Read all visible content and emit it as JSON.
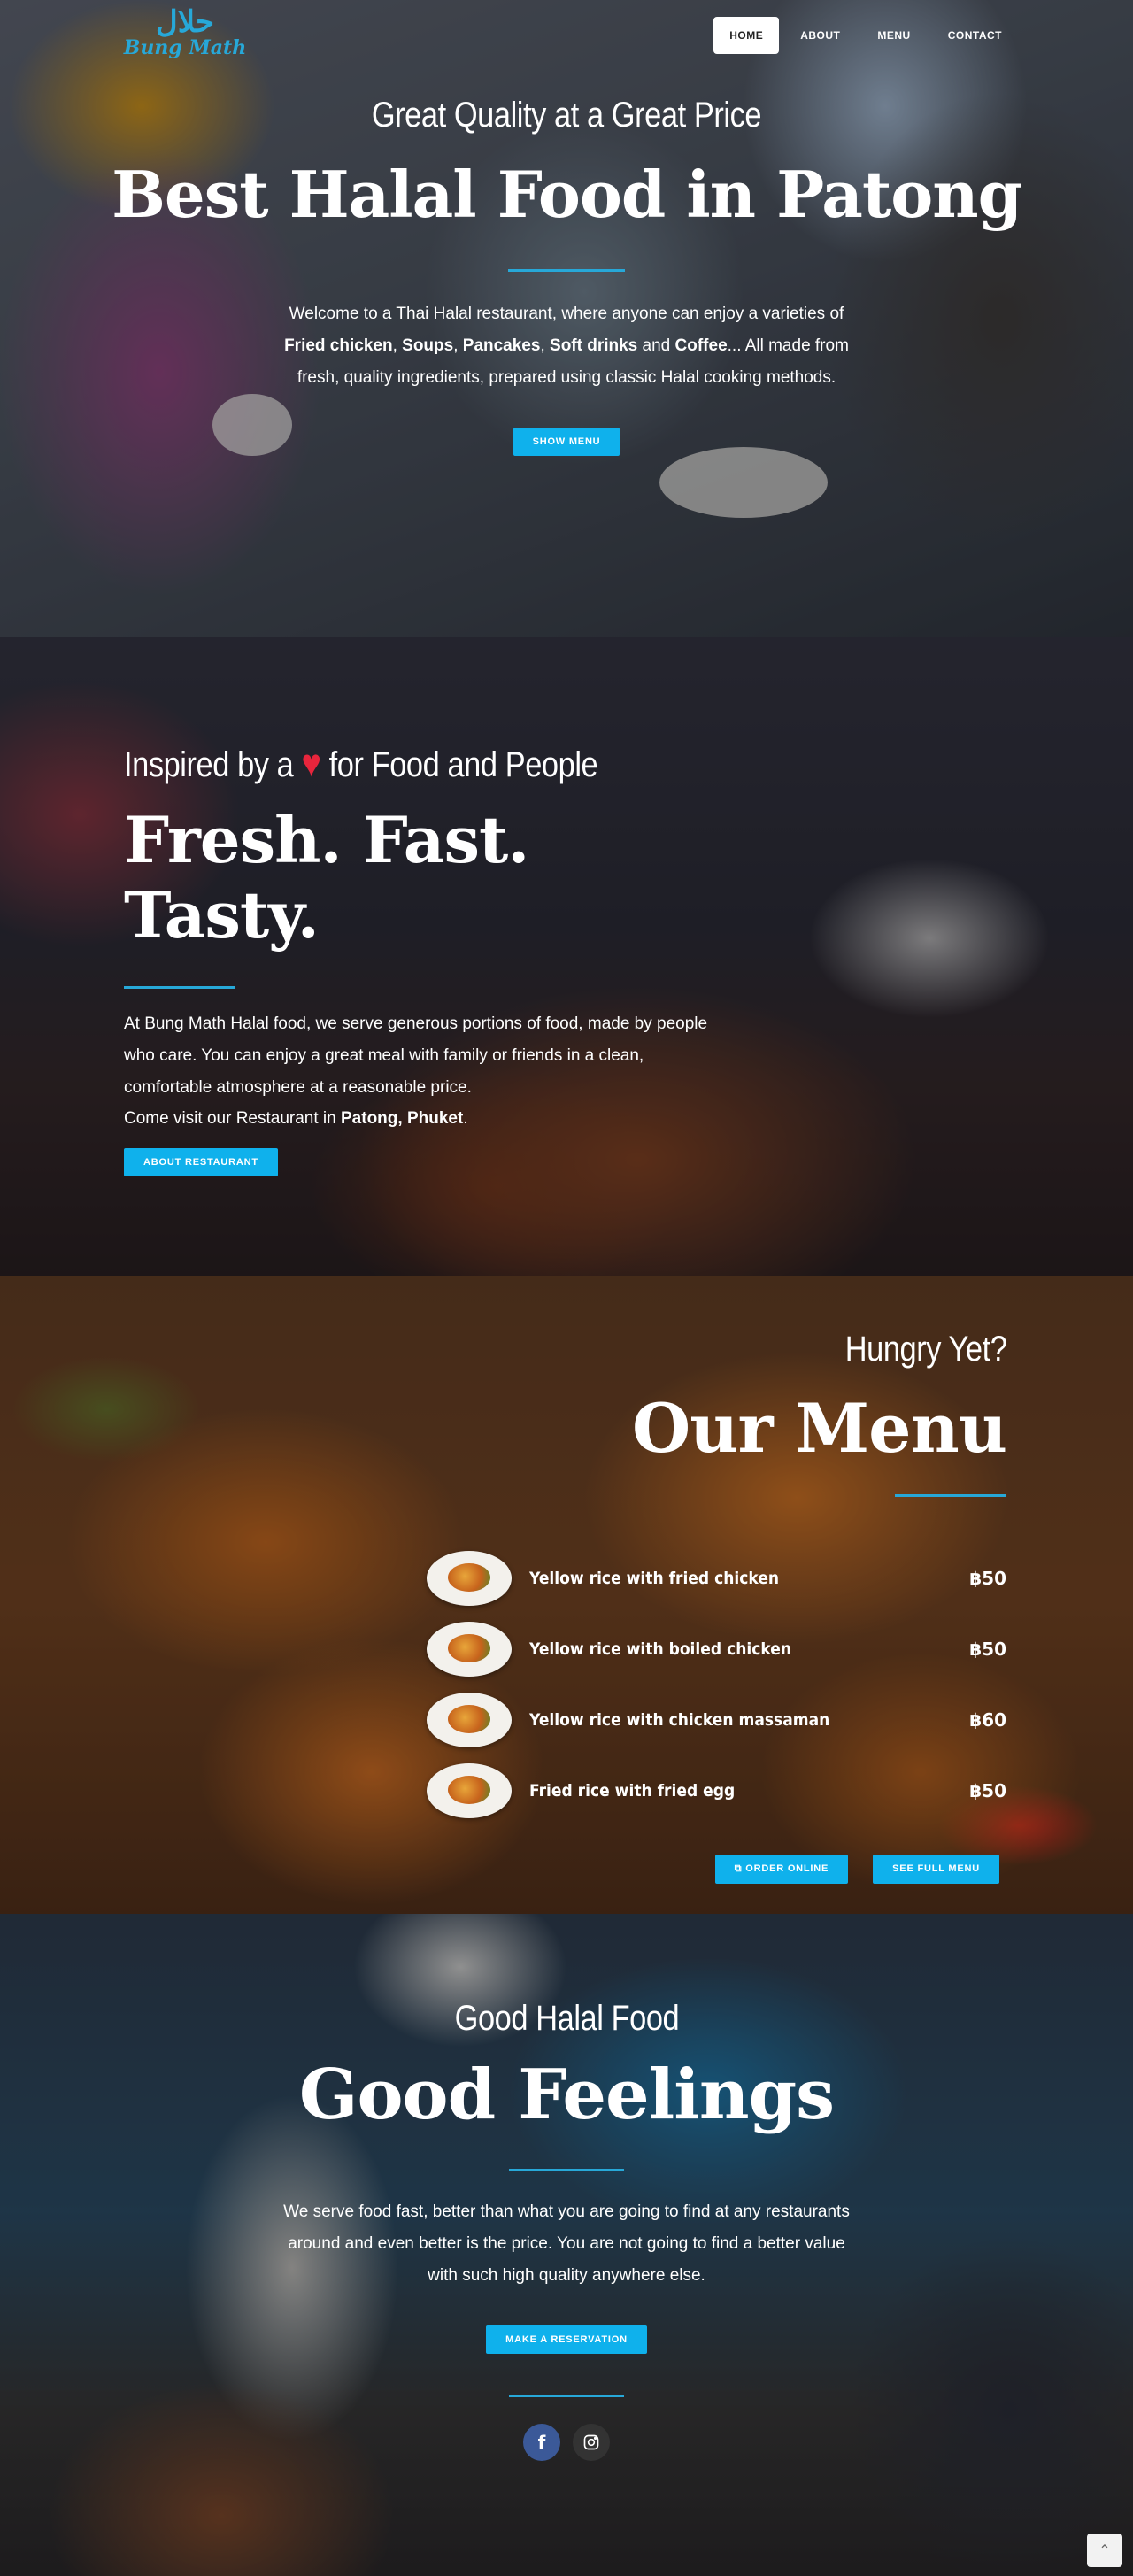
{
  "logo": {
    "arabic": "حلال",
    "name": "Bung Math"
  },
  "nav": {
    "items": [
      "HOME",
      "ABOUT",
      "MENU",
      "CONTACT"
    ]
  },
  "hero": {
    "subtitle": "Great Quality at a Great Price",
    "title": "Best Halal Food in Patong",
    "intro": "Welcome to a Thai Halal restaurant, where anyone can enjoy a varieties of ",
    "items": [
      "Fried chicken",
      "Soups",
      "Pancakes",
      "Soft drinks",
      "Coffee"
    ],
    "sep1": ", ",
    "sep2": ", ",
    "sep3": ", ",
    "and": " and ",
    "outro": "... All made from fresh, quality ingredients, prepared using classic Halal cooking methods.",
    "button": "SHOW MENU"
  },
  "about": {
    "subtitle_before": "Inspired by a ",
    "subtitle_after": " for Food and People",
    "title": "Fresh. Fast. Tasty.",
    "body": "At Bung Math Halal food, we serve generous portions of food, made by people who care. You can enjoy a great meal with family or friends in a clean, comfortable atmosphere at a reasonable price.",
    "visit_before": "Come visit our Restaurant in ",
    "visit_place": "Patong, Phuket",
    "visit_after": ".",
    "button": "ABOUT RESTAURANT"
  },
  "menu": {
    "subtitle": "Hungry Yet?",
    "title": "Our Menu",
    "items": [
      {
        "name": "Yellow rice with fried chicken",
        "price": "฿50"
      },
      {
        "name": "Yellow rice with boiled chicken",
        "price": "฿50"
      },
      {
        "name": "Yellow rice with chicken massaman",
        "price": "฿60"
      },
      {
        "name": "Fried rice with fried egg",
        "price": "฿50"
      }
    ],
    "order_button": "ORDER ONLINE",
    "full_menu_button": "SEE FULL MENU"
  },
  "feelings": {
    "subtitle": "Good Halal Food",
    "title": "Good Feelings",
    "body": "We serve food fast, better than what you are going to find at any restaurants around and even better is the price. You are not going to find a better value with such high quality anywhere else.",
    "button": "MAKE A RESERVATION",
    "social": {
      "facebook": "f"
    }
  },
  "colors": {
    "accent": "#0fb1ec",
    "rule": "#27a8d8",
    "heart": "#e8253c"
  },
  "icons": [
    "heart-icon",
    "external-link-icon",
    "facebook-icon",
    "instagram-icon",
    "chevron-up-icon"
  ]
}
